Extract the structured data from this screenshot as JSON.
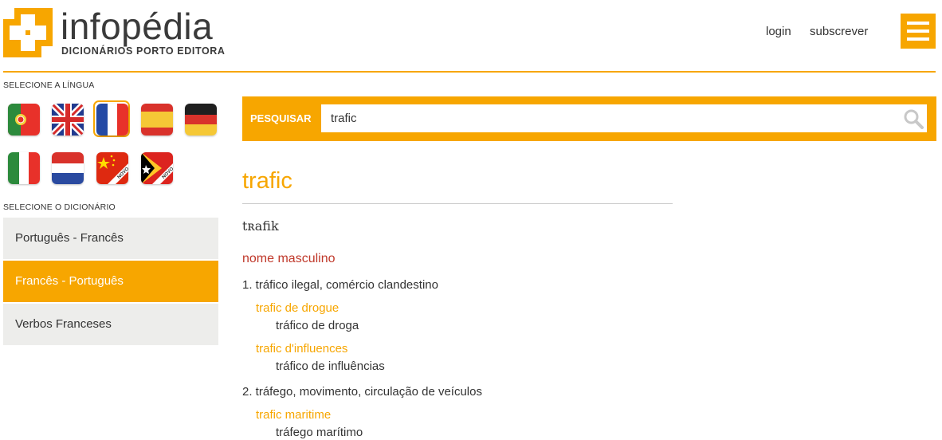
{
  "header": {
    "logo_title": "infopédia",
    "logo_subtitle": "DICIONÁRIOS PORTO EDITORA",
    "login": "login",
    "subscribe": "subscrever",
    "menu_icon": "hamburger-icon",
    "accent_color": "#f7a600"
  },
  "sidebar": {
    "language_label": "SELECIONE A LÍNGUA",
    "languages": [
      {
        "name": "portuguese-flag",
        "selected": false,
        "badge": ""
      },
      {
        "name": "english-flag",
        "selected": false,
        "badge": ""
      },
      {
        "name": "french-flag",
        "selected": true,
        "badge": ""
      },
      {
        "name": "spanish-flag",
        "selected": false,
        "badge": ""
      },
      {
        "name": "german-flag",
        "selected": false,
        "badge": ""
      },
      {
        "name": "italian-flag",
        "selected": false,
        "badge": ""
      },
      {
        "name": "dutch-flag",
        "selected": false,
        "badge": ""
      },
      {
        "name": "chinese-flag",
        "selected": false,
        "badge": "NOVO"
      },
      {
        "name": "timor-leste-flag",
        "selected": false,
        "badge": "NOVO"
      }
    ],
    "dictionary_label": "SELECIONE O DICIONÁRIO",
    "dictionaries": [
      {
        "label": "Português - Francês",
        "active": false
      },
      {
        "label": "Francês - Português",
        "active": true
      },
      {
        "label": "Verbos Franceses",
        "active": false
      }
    ]
  },
  "search": {
    "label": "PESQUISAR",
    "value": "trafic",
    "icon": "search-icon"
  },
  "entry": {
    "headword": "trafic",
    "pronunciation": "tʀafik",
    "part_of_speech": "nome masculino",
    "senses": [
      {
        "text": "1. tráfico ilegal, comércio clandestino",
        "examples": [
          {
            "fr": "trafic de drogue",
            "pt": "tráfico de droga"
          },
          {
            "fr": "trafic d'influences",
            "pt": "tráfico de influências"
          }
        ]
      },
      {
        "text": "2. tráfego, movimento, circulação de veículos",
        "examples": [
          {
            "fr": "trafic maritime",
            "pt": "tráfego marítimo"
          }
        ]
      }
    ]
  }
}
